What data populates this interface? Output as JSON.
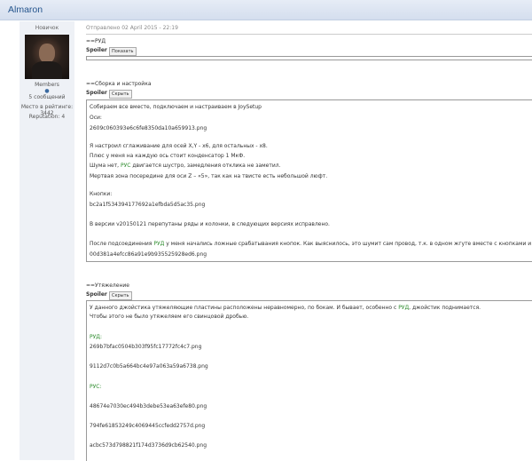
{
  "header": {
    "username": "Almaron"
  },
  "profile": {
    "rank": "Новичок",
    "group": "Members",
    "dot": "●",
    "posts": "5 сообщений",
    "rating_label": "Место в рейтинге:",
    "rating_value": "3442",
    "reputation_label": "Reputation:",
    "reputation_value": "4"
  },
  "post": {
    "date": "Отправлено 02 April 2015 - 22:19",
    "h1": "==РУД",
    "spoiler_label": "Spoiler",
    "btn_show": "Показать",
    "btn_hide": "Скрыть",
    "h2": "==Сборка и настройка",
    "h3": "==Утяжеление"
  },
  "spoiler2": {
    "l1": "Собираем все вместе, подключаем и настраиваем в JoySetup",
    "l2": "Оси:",
    "l3": "2609c060393e6c6fe8350da10a659913.png",
    "l4": "Я настроил сглаживание для осей X,Y - x6, для остальных - x8.",
    "l5": "Плюс у меня на каждую ось стоит конденсатор 1 МкФ.",
    "l6a": "Шума нет, ",
    "l6b": "РУС",
    "l6c": " двигается шустро, замедления отклика не заметил.",
    "l7": "Мертвая зона посередине для оси Z – «5», так как на твисте есть небольшой люфт.",
    "l8": "Кнопки:",
    "l9": "bc2a1f534394177692a1efbda5d5ac35.png",
    "l10": "В версии v20150121 перепутаны ряды и колонки, в следующих версиях исправлено.",
    "l11a": "После подсоединения ",
    "l11b": "РУД",
    "l11c": " у меня начались ложные срабатывания кнопок. Как выяснилось, это шумит сам провод, т.к. в одном жгуте вместе с кнопками и",
    "l12": "00d381a4efcc86a91e9b935525928ed6.png"
  },
  "spoiler3": {
    "l1a": "У данного джойстика утяжеляющие пластины расположены неравномерно, по бокам. И бывает, особенно с ",
    "l1b": "РУД",
    "l1c": ", джойстик поднимается.",
    "l2": "Чтобы этого не было утяжеляем его свинцовой дробью.",
    "l3": "РУД:",
    "l4": "269b7bfac0504b303f95fc17772fc4c7.png",
    "l5": "9112d7c0b5a664bc4e97a063a59a6738.png",
    "l6": "РУС:",
    "l7": "48674e7030ec494b3debe53ea63efe80.png",
    "l8": "794fe61853249c4069445ccfedd2757d.png",
    "l9": "acbc573d798821f174d3736d9cb62540.png"
  }
}
